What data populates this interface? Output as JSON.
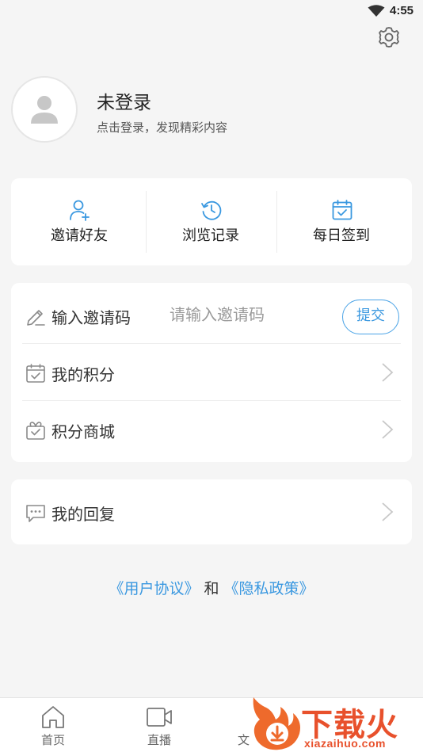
{
  "status_bar": {
    "time": "4:55"
  },
  "profile": {
    "name": "未登录",
    "subtitle": "点击登录，发现精彩内容"
  },
  "quick_actions": [
    {
      "label": "邀请好友",
      "icon": "add-user-icon"
    },
    {
      "label": "浏览记录",
      "icon": "history-icon"
    },
    {
      "label": "每日签到",
      "icon": "calendar-check-icon"
    }
  ],
  "menu": {
    "invite": {
      "label": "输入邀请码",
      "placeholder": "请输入邀请码",
      "value": "",
      "submit_label": "提交"
    },
    "items": [
      {
        "label": "我的积分",
        "icon": "points-calendar-icon"
      },
      {
        "label": "积分商城",
        "icon": "gift-box-icon"
      }
    ]
  },
  "reply": {
    "label": "我的回复",
    "icon": "chat-bubble-icon"
  },
  "agreements": {
    "user_agreement": "《用户协议》",
    "and": "和",
    "privacy_policy": "《隐私政策》"
  },
  "tabs": [
    {
      "label": "首页",
      "icon": "home-icon"
    },
    {
      "label": "直播",
      "icon": "video-camera-icon"
    },
    {
      "label": "文",
      "icon": ""
    }
  ],
  "watermark": {
    "text": "下载火",
    "url": "xiazaihuo.com"
  },
  "colors": {
    "accent": "#3a98e0",
    "background": "#f5f5f5",
    "icon_gray": "#8a8a8a",
    "watermark": "#e8512c"
  }
}
